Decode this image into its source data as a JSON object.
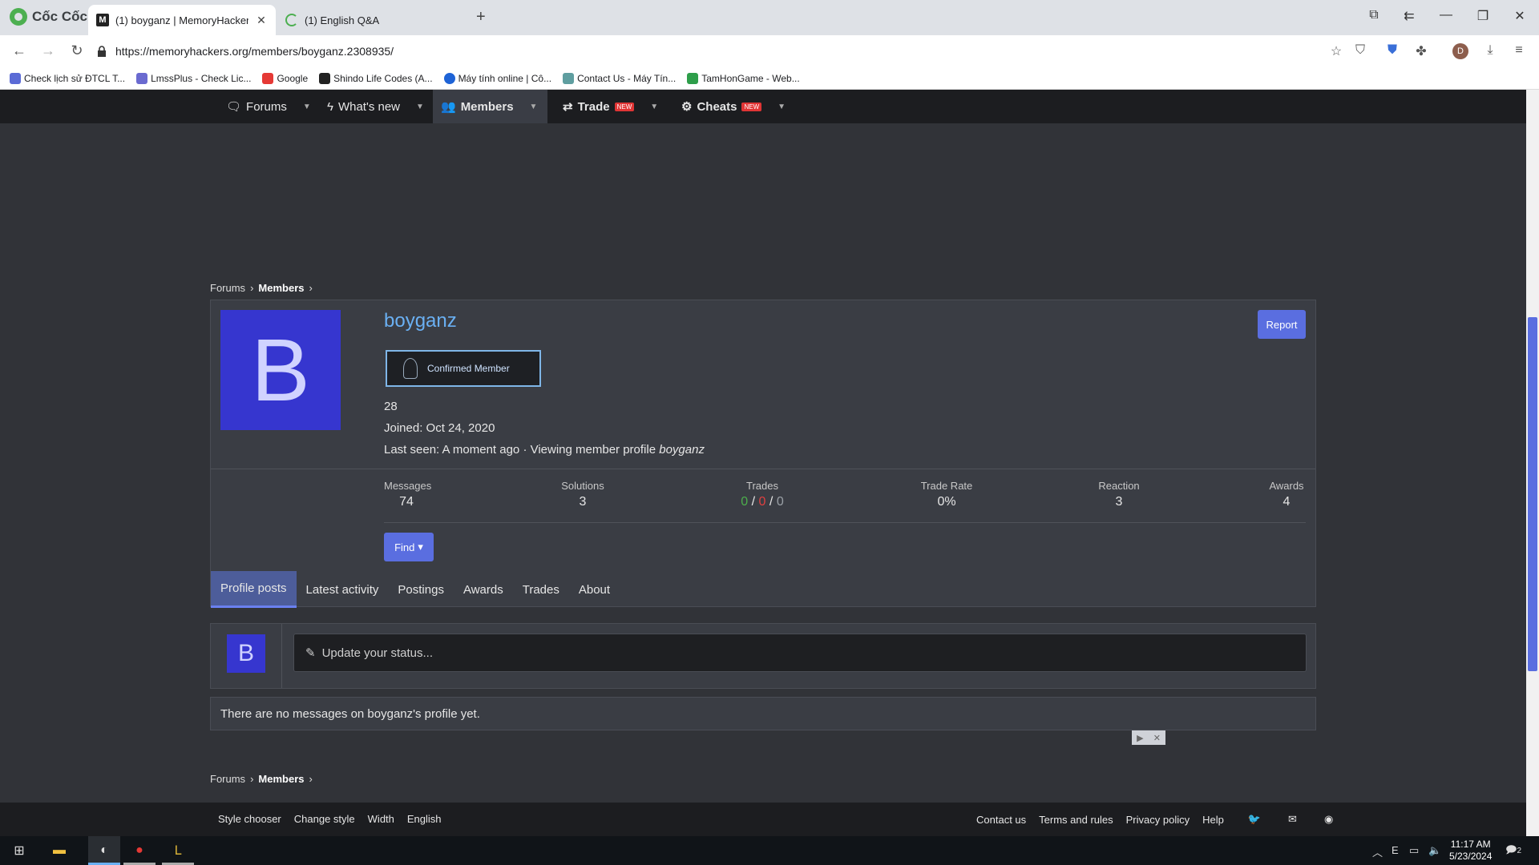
{
  "browser": {
    "brand": "Cốc Cốc",
    "tabs": [
      {
        "title": "(1) boyganz | MemoryHacker",
        "active": true
      },
      {
        "title": "(1) English Q&A",
        "active": false
      }
    ],
    "url": "https://memoryhackers.org/members/boyganz.2308935/",
    "profile_initial": "D",
    "bookmarks": [
      {
        "label": "Check lịch sử ĐTCL T...",
        "color": "#5b6bd6"
      },
      {
        "label": "LmssPlus - Check Lic...",
        "color": "#6a6ad0"
      },
      {
        "label": "Google",
        "color": "#e53935"
      },
      {
        "label": "Shindo Life Codes (A...",
        "color": "#222222"
      },
      {
        "label": "Máy tính online | Cô...",
        "color": "#1e63d6"
      },
      {
        "label": "Contact Us - Máy Tín...",
        "color": "#5f9ea0"
      },
      {
        "label": "TamHonGame - Web...",
        "color": "#2e9e4a"
      }
    ]
  },
  "nav": {
    "items": [
      {
        "label": "Forums",
        "icon": "chat-icon"
      },
      {
        "label": "What's new",
        "icon": "bolt-icon"
      },
      {
        "label": "Members",
        "icon": "users-icon",
        "active": true
      },
      {
        "label": "Trade",
        "icon": "swap-icon",
        "badge": "NEW"
      },
      {
        "label": "Cheats",
        "icon": "gear-icon",
        "badge": "NEW"
      }
    ]
  },
  "breadcrumb": {
    "first": "Forums",
    "second": "Members"
  },
  "profile": {
    "avatar_letter": "B",
    "username": "boyganz",
    "report_label": "Report",
    "badge_label": "Confirmed Member",
    "count": "28",
    "joined": "Joined: Oct 24, 2020",
    "last_seen": "Last seen: A moment ago · Viewing member profile ",
    "last_seen_name": "boyganz",
    "stats": {
      "messages_label": "Messages",
      "messages": "74",
      "solutions_label": "Solutions",
      "solutions": "3",
      "trades_label": "Trades",
      "trades_pos": "0",
      "trades_neg": "0",
      "trades_neu": "0",
      "trades_sep": "/",
      "trade_rate_label": "Trade Rate",
      "trade_rate": "0%",
      "reaction_label": "Reaction",
      "reaction": "3",
      "awards_label": "Awards",
      "awards": "4"
    },
    "find_label": "Find",
    "tabs": [
      "Profile posts",
      "Latest activity",
      "Postings",
      "Awards",
      "Trades",
      "About"
    ]
  },
  "status": {
    "avatar_letter": "B",
    "placeholder": "Update your status..."
  },
  "no_messages": "There are no messages on boyganz's profile yet.",
  "footer": {
    "left": [
      "Style chooser",
      "Change style",
      "Width",
      "English"
    ],
    "right": [
      "Contact us",
      "Terms and rules",
      "Privacy policy",
      "Help"
    ]
  },
  "taskbar": {
    "time": "11:17 AM",
    "date": "5/23/2024",
    "notifications": "2"
  },
  "colors": {
    "accent": "#5a6ee0",
    "username": "#6ab0f3",
    "avatar_bg": "#3636cf",
    "positive": "#4cae4c",
    "negative": "#e04040"
  }
}
